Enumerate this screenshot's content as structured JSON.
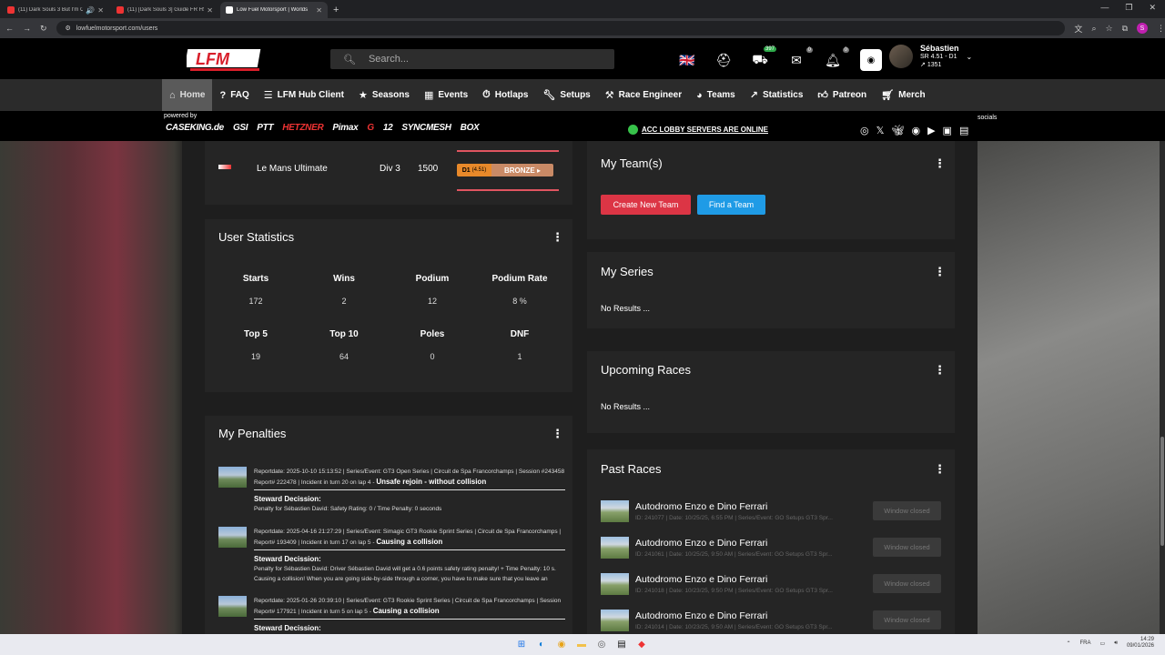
{
  "browser": {
    "tabs": [
      {
        "title": "(11) Dark Souls 3 But I'm Cl",
        "audio": "🔊"
      },
      {
        "title": "(11) [Dark Souls 3] Guide FR HS"
      },
      {
        "title": "Low Fuel Motorsport | Worlds"
      }
    ],
    "url": "lowfuelmotorsport.com/users",
    "profile_initial": "S"
  },
  "header": {
    "search_placeholder": "Search...",
    "badges": {
      "license": "397",
      "messages": "0",
      "notifications": "0"
    },
    "user": {
      "name": "Sébastien",
      "sr": "SR 4.51 - D1",
      "elo": "1351"
    }
  },
  "nav": {
    "items": [
      "Home",
      "FAQ",
      "LFM Hub Client",
      "Seasons",
      "Events",
      "Hotlaps",
      "Setups",
      "Race Engineer",
      "Teams",
      "Statistics",
      "Patreon",
      "Merch"
    ]
  },
  "sponsors": {
    "powered_by": "powered by",
    "logos": [
      "CASEKING.de",
      "GSI",
      "PTT",
      "HETZNER",
      "Pimax",
      "G",
      "12",
      "SYNCMESH",
      "BOX"
    ],
    "servers_status": "ACC LOBBY SERVERS ARE ONLINE",
    "socials_label": "socials"
  },
  "series_row": {
    "game": "Le Mans Ultimate",
    "division": "Div 3",
    "elo": "1500",
    "rank_div": "D1",
    "rank_sr": "(4.51)",
    "rank_class": "BRONZE"
  },
  "user_statistics": {
    "title": "User Statistics",
    "items": [
      {
        "label": "Starts",
        "value": "172"
      },
      {
        "label": "Wins",
        "value": "2"
      },
      {
        "label": "Podium",
        "value": "12"
      },
      {
        "label": "Podium Rate",
        "value": "8 %"
      },
      {
        "label": "Top 5",
        "value": "19"
      },
      {
        "label": "Top 10",
        "value": "64"
      },
      {
        "label": "Poles",
        "value": "0"
      },
      {
        "label": "DNF",
        "value": "1"
      }
    ]
  },
  "penalties": {
    "title": "My Penalties",
    "steward_label": "Steward Decission:",
    "items": [
      {
        "meta1": "Reportdate: 2025-10-10 15:13:52 | Series/Event: GT3 Open Series | Circuit de Spa Francorchamps | Session #243458",
        "meta2": "Report# 222478 | Incident in turn 20 on lap 4 - ",
        "reason": "Unsafe rejoin - without collision",
        "text": "Penalty for Sébastien David: Safety Rating: 0 / Time Penalty: 0 seconds"
      },
      {
        "meta1": "Reportdate: 2025-04-16 21:27:29 | Series/Event: Simagic GT3 Rookie Sprint Series | Circuit de Spa Francorchamps |",
        "meta2": "Report# 193409 | Incident in turn 17 on lap 5 - ",
        "reason": "Causing a collision",
        "text": "Penalty for Sébastien David: Driver Sébastien David will get a 0.6 points safety rating penalty! + Time Penalty: 10 s. Causing a collision! When you are going side-by-side through a corner, you have to make sure that you leave an"
      },
      {
        "meta1": "Reportdate: 2025-01-26 20:39:10 | Series/Event: GT3 Rookie Sprint Series | Circuit de Spa Francorchamps | Session",
        "meta2": "Report# 177921 | Incident in turn 5 on lap 5 - ",
        "reason": "Causing a collision",
        "text": ""
      }
    ]
  },
  "my_teams": {
    "title": "My Team(s)",
    "create_label": "Create New Team",
    "find_label": "Find a Team"
  },
  "my_series": {
    "title": "My Series",
    "empty": "No Results ..."
  },
  "upcoming": {
    "title": "Upcoming Races",
    "empty": "No Results ..."
  },
  "past_races": {
    "title": "Past Races",
    "button_label": "Window closed",
    "items": [
      {
        "name": "Autodromo Enzo e Dino Ferrari",
        "meta": "ID: 241077 | Date: 10/25/25, 6:55 PM | Series/Event: GO Setups GT3 Spr..."
      },
      {
        "name": "Autodromo Enzo e Dino Ferrari",
        "meta": "ID: 241061 | Date: 10/25/25, 9:50 AM | Series/Event: GO Setups GT3 Spr..."
      },
      {
        "name": "Autodromo Enzo e Dino Ferrari",
        "meta": "ID: 241018 | Date: 10/23/25, 9:50 PM | Series/Event: GO Setups GT3 Spr..."
      },
      {
        "name": "Autodromo Enzo e Dino Ferrari",
        "meta": "ID: 241014 | Date: 10/23/25, 9:50 AM | Series/Event: GO Setups GT3 Spr..."
      }
    ]
  },
  "taskbar": {
    "lang": "FRA",
    "time": "14:29",
    "date": "09/01/2026"
  }
}
